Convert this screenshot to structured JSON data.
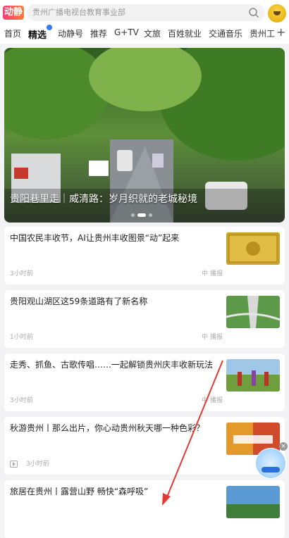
{
  "header": {
    "logo_text": "动静",
    "search_placeholder": "贵州广播电视台教育事业部",
    "icons": [
      "search-icon",
      "avatar-icon"
    ]
  },
  "tabs": [
    {
      "label": "首页",
      "active": false
    },
    {
      "label": "精选",
      "active": true
    },
    {
      "label": "动静号",
      "active": false
    },
    {
      "label": "推荐",
      "active": false
    },
    {
      "label": "G+TV",
      "active": false
    },
    {
      "label": "文旅",
      "active": false
    },
    {
      "label": "百姓就业",
      "active": false
    },
    {
      "label": "交通音乐",
      "active": false
    },
    {
      "label": "贵州工",
      "active": false
    },
    {
      "label": "+",
      "active": false
    }
  ],
  "hero": {
    "title": "贵阳巷里走｜威清路：岁月织就的老城秘境",
    "dots": 3,
    "active_dot": 1
  },
  "cards": [
    {
      "title": "中国农民丰收节，AI让贵州丰收图景“动”起来",
      "time": "3小时前",
      "source": "中 播报",
      "thumb": "gold-art"
    },
    {
      "title": "贵阳观山湖区这59条道路有了新名称",
      "time": "1小时前",
      "source": "中 播报",
      "thumb": "road-aerial"
    },
    {
      "title": "走秀、抓鱼、古歌传唱……一起解锁贵州庆丰收新玩法",
      "time": "3小时前",
      "source": "中 播报",
      "thumb": "festival"
    },
    {
      "title": "秋游贵州丨那么出片，你心动贵州秋天哪一种色彩？",
      "time": "3小时前",
      "source": "中 播报",
      "thumb": "autumn",
      "video": true
    },
    {
      "title": "旅居在贵州丨露营山野 畅快“森呼吸”",
      "time": "",
      "source": "",
      "thumb": "camping"
    }
  ],
  "colors": {
    "accent": "#3a7af0",
    "arrow": "#e53935"
  }
}
